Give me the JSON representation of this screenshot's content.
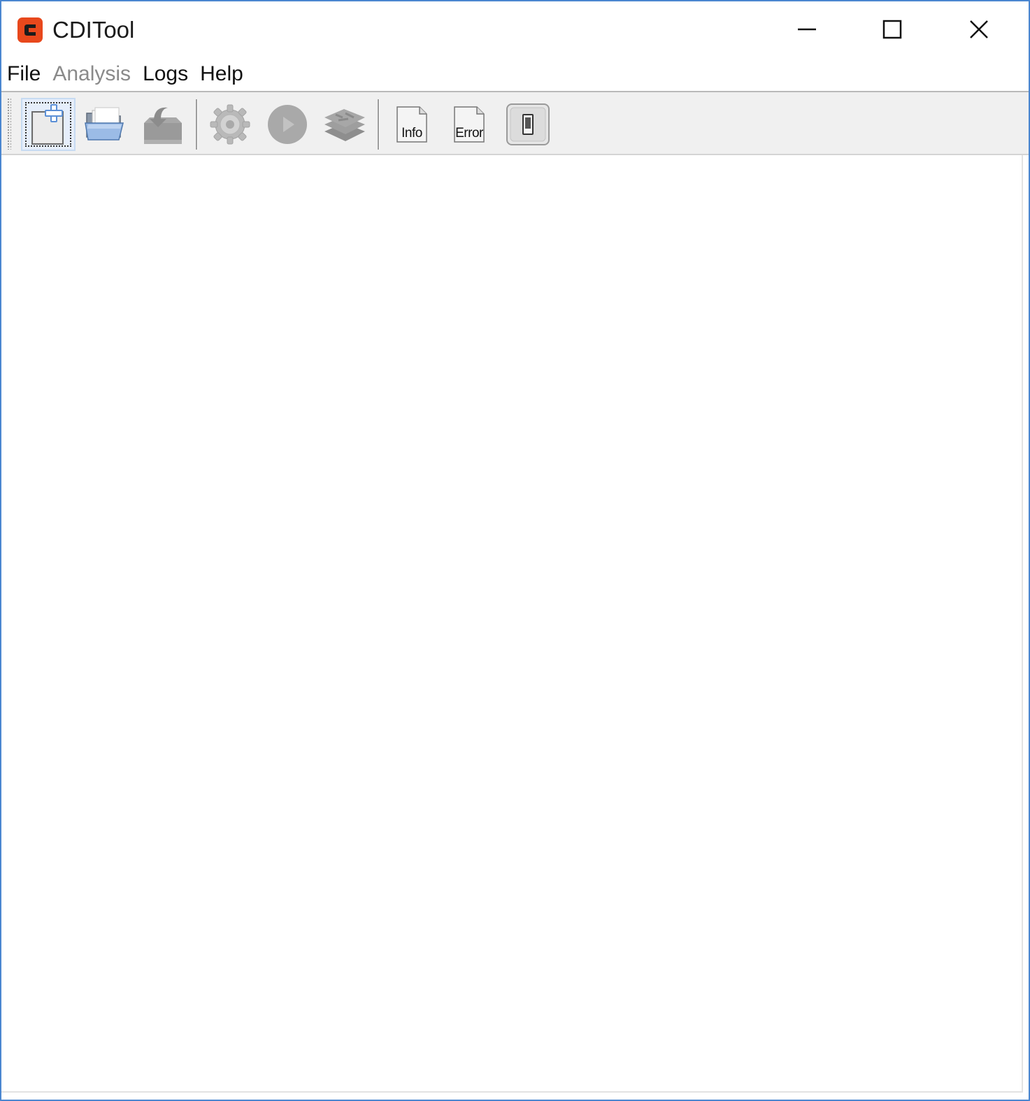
{
  "window": {
    "title": "CDITool",
    "logo_icon": "app-logo-icon",
    "logo_color": "#e8481c",
    "border_color": "#4a86d0"
  },
  "window_controls": {
    "minimize_icon": "minimize-icon",
    "maximize_icon": "maximize-icon",
    "close_icon": "close-icon"
  },
  "menu": {
    "items": [
      {
        "label": "File",
        "enabled": true
      },
      {
        "label": "Analysis",
        "enabled": false
      },
      {
        "label": "Logs",
        "enabled": true
      },
      {
        "label": "Help",
        "enabled": true
      }
    ]
  },
  "toolbar": {
    "buttons": [
      {
        "icon": "new-document-icon",
        "enabled": true,
        "focused": true
      },
      {
        "icon": "open-folder-icon",
        "enabled": true
      },
      {
        "icon": "save-download-icon",
        "enabled": false
      },
      {
        "icon": "settings-gear-icon",
        "enabled": false
      },
      {
        "icon": "play-run-icon",
        "enabled": false
      },
      {
        "icon": "layers-icon",
        "enabled": false
      },
      {
        "icon": "info-log-icon",
        "label": "Info",
        "enabled": true
      },
      {
        "icon": "error-log-icon",
        "label": "Error",
        "enabled": true
      },
      {
        "icon": "toggle-switch-icon",
        "enabled": true
      }
    ]
  }
}
